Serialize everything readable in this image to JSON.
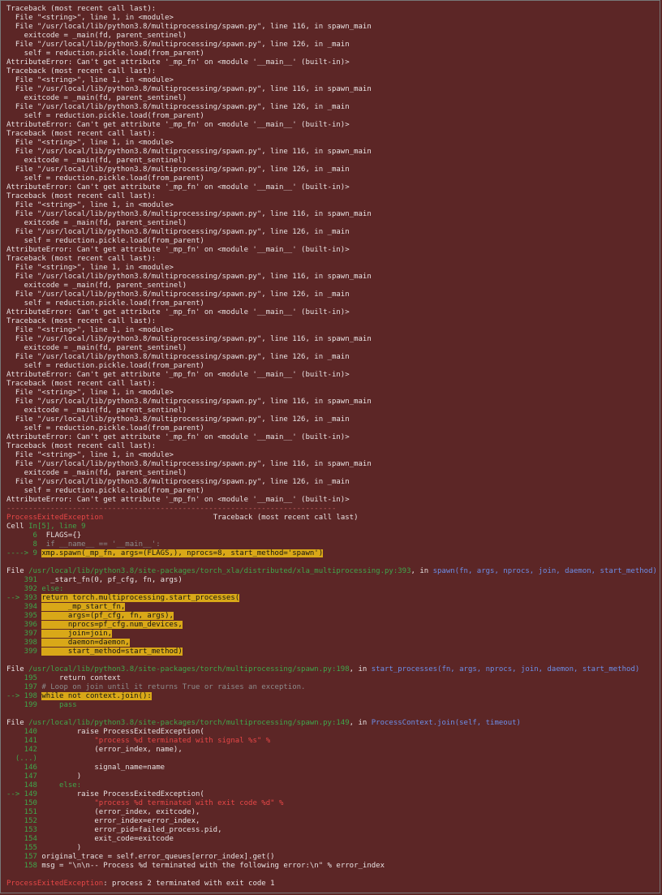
{
  "repeat_count": 8,
  "traceback_block": [
    "Traceback (most recent call last):",
    "  File \"<string>\", line 1, in <module>",
    "  File \"/usr/local/lib/python3.8/multiprocessing/spawn.py\", line 116, in spawn_main",
    "    exitcode = _main(fd, parent_sentinel)",
    "  File \"/usr/local/lib/python3.8/multiprocessing/spawn.py\", line 126, in _main",
    "    self = reduction.pickle.load(from_parent)",
    "AttributeError: Can't get attribute '_mp_fn' on <module '__main__' (built-in)>"
  ],
  "separator": "---------------------------------------------------------------------------",
  "exception_name": "ProcessExitedException",
  "traceback_header": "Traceback (most recent call last)",
  "cell_label": "Cell",
  "cell_ref": "In[5], line 9",
  "cell_lines": [
    {
      "no": "6",
      "code": " FLAGS={}",
      "kind": "normal"
    },
    {
      "no": "8",
      "code": " if __name__ == '__main__':",
      "kind": "dim"
    },
    {
      "no": "9",
      "arrow": "----> ",
      "code": "xmp.spawn(_mp_fn, args=(FLAGS,), nprocs=8, start_method='spawn')",
      "kind": "current"
    }
  ],
  "frames": [
    {
      "file_label": "File",
      "path": "/usr/local/lib/python3.8/site-packages/torch_xla/distributed/xla_multiprocessing.py:393",
      "in_label": ", in",
      "func": "spawn(fn, args, nprocs, join, daemon, start_method)",
      "lines": [
        {
          "no": "391",
          "code": "  _start_fn(0, pf_cfg, fn, args)",
          "kind": "normal"
        },
        {
          "no": "392",
          "code": "else:",
          "kind": "grn"
        },
        {
          "no": "393",
          "arrow": "--> ",
          "code": "return torch.multiprocessing.start_processes(",
          "kind": "current"
        },
        {
          "no": "394",
          "code": "      _mp_start_fn,",
          "kind": "hl"
        },
        {
          "no": "395",
          "code": "      args=(pf_cfg, fn, args),",
          "kind": "hl"
        },
        {
          "no": "396",
          "code": "      nprocs=pf_cfg.num_devices,",
          "kind": "hl"
        },
        {
          "no": "397",
          "code": "      join=join,",
          "kind": "hl"
        },
        {
          "no": "398",
          "code": "      daemon=daemon,",
          "kind": "hl"
        },
        {
          "no": "399",
          "code": "      start_method=start_method)",
          "kind": "hl"
        }
      ]
    },
    {
      "file_label": "File",
      "path": "/usr/local/lib/python3.8/site-packages/torch/multiprocessing/spawn.py:198",
      "in_label": ", in",
      "func": "start_processes(fn, args, nprocs, join, daemon, start_method)",
      "lines": [
        {
          "no": "195",
          "code": "    return context",
          "kind": "normal"
        },
        {
          "no": "197",
          "code": "# Loop on join until it returns True or raises an exception.",
          "kind": "dim"
        },
        {
          "no": "198",
          "arrow": "--> ",
          "code": "while not context.join():",
          "kind": "current"
        },
        {
          "no": "199",
          "code": "    pass",
          "kind": "grn"
        }
      ]
    },
    {
      "file_label": "File",
      "path": "/usr/local/lib/python3.8/site-packages/torch/multiprocessing/spawn.py:149",
      "in_label": ", in",
      "func": "ProcessContext.join(self, timeout)",
      "lines": [
        {
          "no": "140",
          "code": "        raise ProcessExitedException(",
          "kind": "normal"
        },
        {
          "no": "141",
          "code": "            \"process %d terminated with signal %s\" %",
          "kind": "red"
        },
        {
          "no": "142",
          "code": "            (error_index, name),",
          "kind": "normal"
        },
        {
          "no": "(...)",
          "code": "",
          "kind": "ellipsis"
        },
        {
          "no": "146",
          "code": "            signal_name=name",
          "kind": "normal"
        },
        {
          "no": "147",
          "code": "        )",
          "kind": "normal"
        },
        {
          "no": "148",
          "code": "    else:",
          "kind": "grn"
        },
        {
          "no": "149",
          "arrow": "--> ",
          "code": "        raise ProcessExitedException(",
          "kind": "arrowonly"
        },
        {
          "no": "150",
          "code": "            \"process %d terminated with exit code %d\" %",
          "kind": "red"
        },
        {
          "no": "151",
          "code": "            (error_index, exitcode),",
          "kind": "normal"
        },
        {
          "no": "152",
          "code": "            error_index=error_index,",
          "kind": "normal"
        },
        {
          "no": "153",
          "code": "            error_pid=failed_process.pid,",
          "kind": "normal"
        },
        {
          "no": "154",
          "code": "            exit_code=exitcode",
          "kind": "normal"
        },
        {
          "no": "155",
          "code": "        )",
          "kind": "normal"
        },
        {
          "no": "157",
          "code": "original_trace = self.error_queues[error_index].get()",
          "kind": "normal"
        },
        {
          "no": "158",
          "code": "msg = \"\\n\\n-- Process %d terminated with the following error:\\n\" % error_index",
          "kind": "normal"
        }
      ]
    }
  ],
  "final_error": {
    "name": "ProcessExitedException",
    "message": ": process 2 terminated with exit code 1"
  }
}
